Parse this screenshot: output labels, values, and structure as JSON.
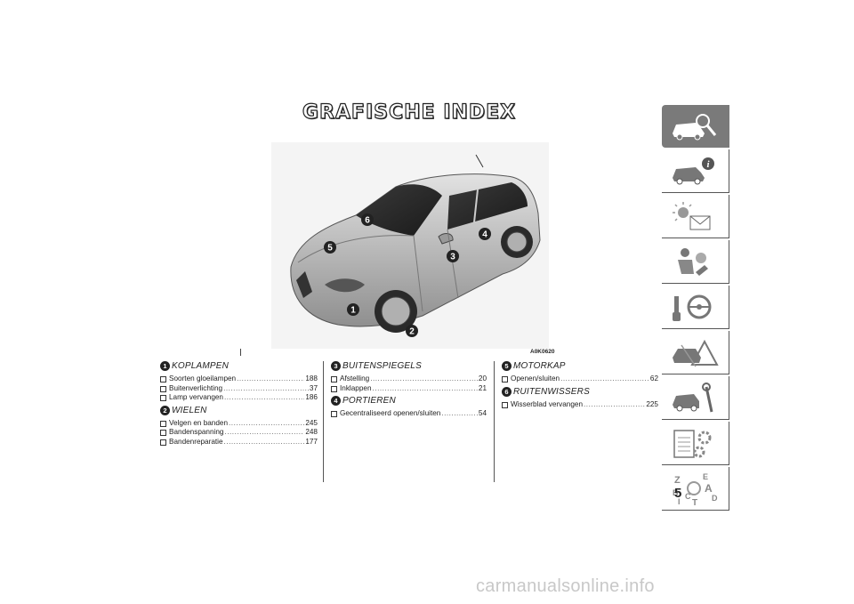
{
  "title": "GRAFISCHE INDEX",
  "figure": {
    "code": "A0K0620",
    "callouts": [
      "1",
      "2",
      "3",
      "4",
      "5",
      "6"
    ]
  },
  "sections": [
    {
      "num": "1",
      "title": "KOPLAMPEN",
      "entries": [
        {
          "label": "Soorten gloeilampen",
          "page": "188"
        },
        {
          "label": "Buitenverlichting",
          "page": "37"
        },
        {
          "label": "Lamp vervangen",
          "page": "186"
        }
      ]
    },
    {
      "num": "2",
      "title": "WIELEN",
      "entries": [
        {
          "label": "Velgen en banden",
          "page": "245"
        },
        {
          "label": "Bandenspanning",
          "page": "248"
        },
        {
          "label": "Bandenreparatie",
          "page": "177"
        }
      ]
    },
    {
      "num": "3",
      "title": "BUITENSPIEGELS",
      "entries": [
        {
          "label": "Afstelling",
          "page": "20"
        },
        {
          "label": "Inklappen",
          "page": "21"
        }
      ]
    },
    {
      "num": "4",
      "title": "PORTIEREN",
      "entries": [
        {
          "label": "Gecentraliseerd openen/sluiten",
          "page": "54"
        }
      ]
    },
    {
      "num": "5",
      "title": "MOTORKAP",
      "entries": [
        {
          "label": "Openen/sluiten",
          "page": "62"
        }
      ]
    },
    {
      "num": "6",
      "title": "RUITENWISSERS",
      "entries": [
        {
          "label": "Wisserblad vervangen",
          "page": "225"
        }
      ]
    }
  ],
  "tabs": [
    {
      "icon": "car-magnifier-icon",
      "active": true
    },
    {
      "icon": "car-info-icon",
      "active": false
    },
    {
      "icon": "warning-light-envelope-icon",
      "active": false
    },
    {
      "icon": "seat-person-airbag-icon",
      "active": false
    },
    {
      "icon": "key-steering-wheel-icon",
      "active": false
    },
    {
      "icon": "car-warning-triangle-icon",
      "active": false
    },
    {
      "icon": "car-wrench-icon",
      "active": false
    },
    {
      "icon": "document-gears-icon",
      "active": false
    },
    {
      "icon": "alphabetical-index-icon",
      "active": false,
      "letters": [
        "Z",
        "E",
        "A",
        "B",
        "C",
        "I",
        "T",
        "D"
      ]
    }
  ],
  "page_number": "5",
  "watermark": "carmanualsonline.info",
  "colors": {
    "tab_active": "#7a7a7a",
    "text": "#222222",
    "car_body": "#b8b8b8"
  }
}
